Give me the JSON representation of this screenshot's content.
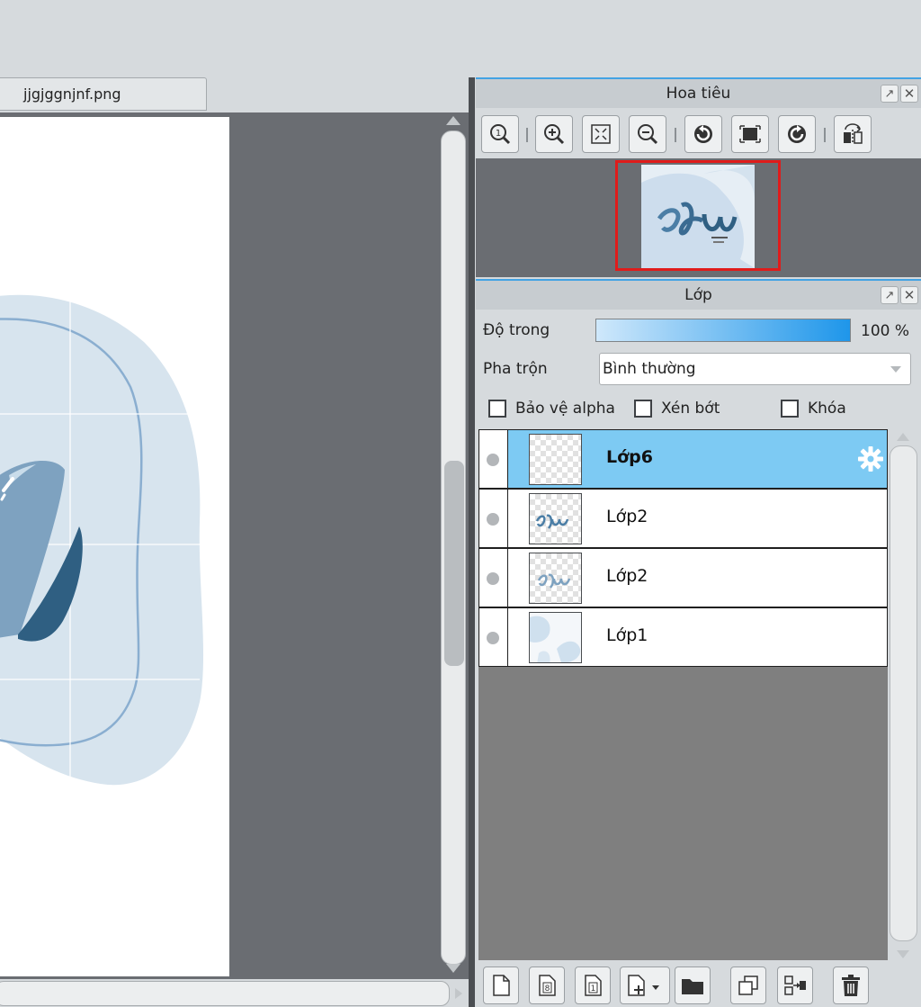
{
  "document": {
    "tab_title": "jjgjggnjnf.png"
  },
  "navigator": {
    "title": "Hoa tiêu",
    "tools": [
      "zoom-actual-icon",
      "zoom-in-icon",
      "fit-window-icon",
      "zoom-out-icon",
      "rotate-left-icon",
      "reset-rotation-icon",
      "rotate-right-icon",
      "flip-horizontal-icon"
    ]
  },
  "layers": {
    "title": "Lớp",
    "opacity_label": "Độ trong",
    "opacity_value": "100 %",
    "opacity_fraction": 1.0,
    "blend_label": "Pha trộn",
    "blend_value": "Bình thường",
    "protect_alpha": "Bảo vệ alpha",
    "clipping": "Xén bớt",
    "lock": "Khóa",
    "items": [
      {
        "name": "Lớp6",
        "selected": true
      },
      {
        "name": "Lớp2",
        "selected": false
      },
      {
        "name": "Lớp2",
        "selected": false
      },
      {
        "name": "Lớp1",
        "selected": false
      }
    ],
    "toolbar": [
      "new-layer-icon",
      "new-8bit-layer-icon",
      "new-1bit-layer-icon",
      "add-layer-dropdown-icon",
      "new-folder-icon",
      "duplicate-layer-icon",
      "merge-down-icon",
      "delete-layer-icon"
    ]
  },
  "colors": {
    "selection": "#7dcaf3",
    "panel_accent": "#43a3e4",
    "navigator_frame": "#e01b1b",
    "art_light_blue": "#d7e4ee",
    "art_dark_blue": "#2f5f82"
  }
}
